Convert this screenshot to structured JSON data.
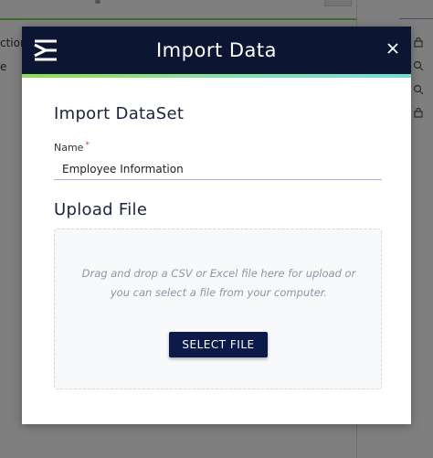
{
  "background": {
    "left_text_1": "ction",
    "left_text_2": "e"
  },
  "modal": {
    "title": "Import Data",
    "close_label": "×",
    "dataset_section_title": "Import DataSet",
    "name_label": "Name",
    "name_required_mark": "*",
    "name_value": "Employee Information",
    "upload_section_title": "Upload File",
    "dropzone_text": "Drag and drop a CSV or Excel file here for upload or you can select a file from your computer.",
    "select_file_label": "SELECT FILE"
  },
  "colors": {
    "header_bg": "#0c1633",
    "accent_green": "#8be04e",
    "accent_teal": "#72dcd6",
    "button_bg": "#0c1a4a"
  },
  "icons": [
    "logo-icon",
    "close-icon",
    "lock-icon",
    "search-icon",
    "search-icon",
    "lock-icon"
  ]
}
